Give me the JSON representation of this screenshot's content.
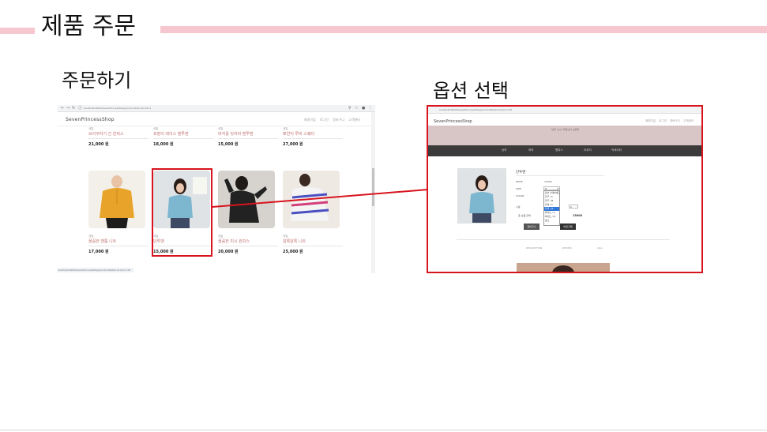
{
  "slide": {
    "title": "제품 주문",
    "left_label": "주문하기",
    "right_label": "옵션 선택",
    "accent_color": "#f7c7cf",
    "highlight_color": "#d8141e"
  },
  "left_screen": {
    "url": "localhost:9000/SevenPrincessShop/productList.do?cat=1",
    "brand": "SevenPrincessShop",
    "top_links": [
      "회원가입",
      "로그인",
      "장바구니",
      "고객센터"
    ],
    "row1": [
      {
        "category": "세일",
        "name": "브이꾸러기 긴 원피스",
        "price": "21,000 원"
      },
      {
        "category": "세일",
        "name": "포장이 레이스 맨투맨",
        "price": "18,000 원"
      },
      {
        "category": "세일",
        "name": "바지를 잊어라 맨투맨",
        "price": "15,000 원"
      },
      {
        "category": "세일",
        "name": "뽀얀이 루비 스웨터",
        "price": "27,000 원"
      }
    ],
    "row2": [
      {
        "category": "세일",
        "name": "꼴꼼한 맨툼 니트",
        "price": "17,000 원",
        "image": "yellow-blouse-photo"
      },
      {
        "category": "세일",
        "name": "단투맨",
        "price": "15,000 원",
        "image": "blue-cardigan-photo"
      },
      {
        "category": "세일",
        "name": "꼴꼼한 미시 원피스",
        "price": "20,000 원",
        "image": "black-dress-photo"
      },
      {
        "category": "세일",
        "name": "알록달록 니트",
        "price": "25,000 원",
        "image": "striped-knit-photo"
      }
    ],
    "status": "localhost:9000/SevenPrincessShop/productDetail.do?pno=18"
  },
  "right_screen": {
    "url": "localhost:9000/SevenPrincessShop/productDetail.do?pno=18",
    "brand": "SevenPrincessShop",
    "top_links": [
      "회원가입",
      "로그인",
      "장바구니",
      "고객센터"
    ],
    "banner": "7공주 Ajax 회원님의 쇼핑몰",
    "nav": [
      "상의",
      "하의",
      "원피스",
      "아우터",
      "악세서리"
    ],
    "product_name": "단투맨",
    "rows": [
      {
        "label": "PRICE",
        "value": "15000"
      },
      {
        "label": "SIZE",
        "value": "S"
      },
      {
        "label": "COLOR",
        "value": ""
      }
    ],
    "dropdown_options": [
      "옵션 선택하세요",
      "블루 / S",
      "블루 / M",
      "블랙 / S",
      "블랙 / M",
      "화이트 / S",
      "화이트 / M",
      "핑크"
    ],
    "selected_index": 4,
    "qty_label": "수량",
    "qty": "1",
    "total_label": "총 상품 금액",
    "total": "15000",
    "cart_button": "장바구니",
    "buy_button": "바로구매",
    "tabs": [
      "DESCRIPTION",
      "REVIEW",
      "Q&A"
    ]
  }
}
